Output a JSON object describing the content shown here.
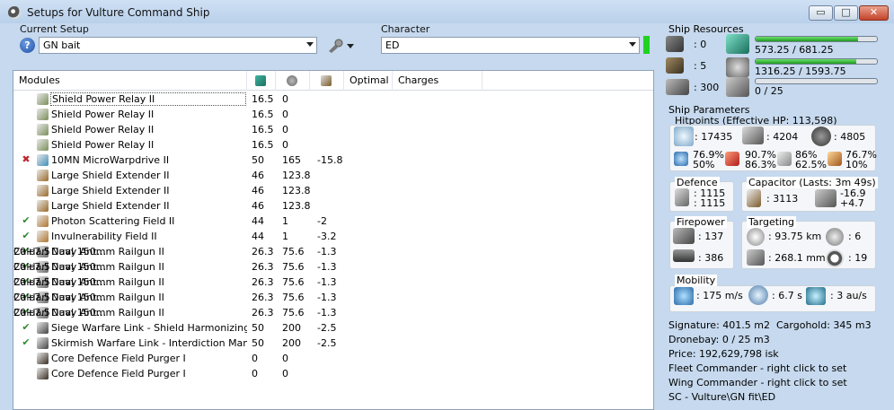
{
  "window": {
    "title": "Setups for Vulture Command Ship",
    "min_glyph": "▭",
    "max_glyph": "□",
    "close_glyph": "✕"
  },
  "setup": {
    "label": "Current Setup",
    "help_glyph": "?",
    "value": "GN bait"
  },
  "character": {
    "label": "Character",
    "value": "ED"
  },
  "modules": {
    "headers": {
      "name": "Modules",
      "optimal": "Optimal",
      "charges": "Charges"
    },
    "rows": [
      {
        "status": "",
        "name": "Shield Power Relay II",
        "cpu": "16.5",
        "pg": "0",
        "cap": "",
        "optimal": "",
        "charges": "",
        "icon_color": "#7a8f5a",
        "selected": true
      },
      {
        "status": "",
        "name": "Shield Power Relay II",
        "cpu": "16.5",
        "pg": "0",
        "cap": "",
        "optimal": "",
        "charges": "",
        "icon_color": "#7a8f5a"
      },
      {
        "status": "",
        "name": "Shield Power Relay II",
        "cpu": "16.5",
        "pg": "0",
        "cap": "",
        "optimal": "",
        "charges": "",
        "icon_color": "#7a8f5a"
      },
      {
        "status": "",
        "name": "Shield Power Relay II",
        "cpu": "16.5",
        "pg": "0",
        "cap": "",
        "optimal": "",
        "charges": "",
        "icon_color": "#7a8f5a"
      },
      {
        "status": "✖",
        "status_kind": "off",
        "name": "10MN MicroWarpdrive II",
        "cpu": "50",
        "pg": "165",
        "cap": "-15.8",
        "optimal": "",
        "charges": "",
        "icon_color": "#3f8fb8"
      },
      {
        "status": "",
        "name": "Large Shield Extender II",
        "cpu": "46",
        "pg": "123.8",
        "cap": "",
        "optimal": "",
        "charges": "",
        "icon_color": "#9a6a2a"
      },
      {
        "status": "",
        "name": "Large Shield Extender II",
        "cpu": "46",
        "pg": "123.8",
        "cap": "",
        "optimal": "",
        "charges": "",
        "icon_color": "#9a6a2a"
      },
      {
        "status": "",
        "name": "Large Shield Extender II",
        "cpu": "46",
        "pg": "123.8",
        "cap": "",
        "optimal": "",
        "charges": "",
        "icon_color": "#9a6a2a"
      },
      {
        "status": "✔",
        "status_kind": "ok",
        "name": "Photon Scattering Field II",
        "cpu": "44",
        "pg": "1",
        "cap": "-2",
        "optimal": "",
        "charges": "",
        "icon_color": "#b0762e"
      },
      {
        "status": "✔",
        "status_kind": "ok",
        "name": "Invulnerability Field II",
        "cpu": "44",
        "pg": "1",
        "cap": "-3.2",
        "optimal": "",
        "charges": "",
        "icon_color": "#b0762e"
      },
      {
        "status": "✔",
        "status_kind": "ok",
        "name": "Dual 150mm Railgun II",
        "cpu": "26.3",
        "pg": "75.6",
        "cap": "-1.3",
        "optimal": "20+7.5",
        "charges": "Caldari Navy Ant...",
        "icon_color": "#6a6a6a"
      },
      {
        "status": "✔",
        "status_kind": "ok",
        "name": "Dual 150mm Railgun II",
        "cpu": "26.3",
        "pg": "75.6",
        "cap": "-1.3",
        "optimal": "20+7.5",
        "charges": "Caldari Navy Ant...",
        "icon_color": "#6a6a6a"
      },
      {
        "status": "✔",
        "status_kind": "ok",
        "name": "Dual 150mm Railgun II",
        "cpu": "26.3",
        "pg": "75.6",
        "cap": "-1.3",
        "optimal": "20+7.5",
        "charges": "Caldari Navy Ant...",
        "icon_color": "#6a6a6a"
      },
      {
        "status": "✔",
        "status_kind": "ok",
        "name": "Dual 150mm Railgun II",
        "cpu": "26.3",
        "pg": "75.6",
        "cap": "-1.3",
        "optimal": "20+7.5",
        "charges": "Caldari Navy Ant...",
        "icon_color": "#6a6a6a"
      },
      {
        "status": "✔",
        "status_kind": "ok",
        "name": "Dual 150mm Railgun II",
        "cpu": "26.3",
        "pg": "75.6",
        "cap": "-1.3",
        "optimal": "20+7.5",
        "charges": "Caldari Navy Ant...",
        "icon_color": "#6a6a6a"
      },
      {
        "status": "✔",
        "status_kind": "ok",
        "name": "Siege Warfare Link - Shield Harmonizing",
        "cpu": "50",
        "pg": "200",
        "cap": "-2.5",
        "optimal": "",
        "charges": "",
        "icon_color": "#444444"
      },
      {
        "status": "✔",
        "status_kind": "ok",
        "name": "Skirmish Warfare Link - Interdiction Maneuv...",
        "cpu": "50",
        "pg": "200",
        "cap": "-2.5",
        "optimal": "",
        "charges": "",
        "icon_color": "#444444"
      },
      {
        "status": "",
        "name": "Core Defence Field Purger I",
        "cpu": "0",
        "pg": "0",
        "cap": "",
        "optimal": "",
        "charges": "",
        "icon_color": "#3a2e22"
      },
      {
        "status": "",
        "name": "Core Defence Field Purger I",
        "cpu": "0",
        "pg": "0",
        "cap": "",
        "optimal": "",
        "charges": "",
        "icon_color": "#3a2e22"
      }
    ]
  },
  "resources": {
    "title": "Ship Resources",
    "turret_slots": ": 0",
    "launcher_slots": ": 5",
    "drone_capacity": ": 300",
    "cpu": "573.25 / 681.25",
    "cpu_fraction": 0.841,
    "powergrid": "1316.25 / 1593.75",
    "powergrid_fraction": 0.826,
    "calibration": "0 / 25",
    "calibration_fraction": 0
  },
  "parameters": {
    "title": "Ship Parameters",
    "hitpoints_title": "Hitpoints (Effective HP: 113,598)",
    "shield_hp": ": 17435",
    "armor_hp": ": 4204",
    "structure_hp": ": 4805",
    "resist_em": "76.9%",
    "resist_em2": "50%",
    "resist_therm": "90.7%",
    "resist_therm2": "86.3%",
    "resist_kin": "86%",
    "resist_kin2": "62.5%",
    "resist_exp": "76.7%",
    "resist_exp2": "10%",
    "defence_title": "Defence",
    "defence_1": ": 1115",
    "defence_2": ": 1115",
    "capacitor_title": "Capacitor (Lasts: 3m 49s)",
    "capacitor_amount": ": 3113",
    "capacitor_delta1": "-16.9",
    "capacitor_delta2": "+4.7",
    "firepower_title": "Firepower",
    "firepower_1": ": 137",
    "firepower_2": ": 386",
    "targeting_title": "Targeting",
    "target_range": ": 93.75 km",
    "max_targets": ": 6",
    "scan_res": ": 268.1 mm",
    "sensor_strength": ": 19",
    "mobility_title": "Mobility",
    "speed": ": 175 m/s",
    "align": ": 6.7 s",
    "warp": ": 3 au/s",
    "signature": "Signature: 401.5 m2",
    "cargohold": "Cargohold: 345 m3",
    "dronebay": "Dronebay: 0 / 25 m3",
    "price": "Price: 192,629,798 isk",
    "fleet_commander": "Fleet Commander - right click to set",
    "wing_commander": "Wing Commander - right click to set",
    "squad_path": "SC - Vulture\\GN fit\\ED"
  }
}
